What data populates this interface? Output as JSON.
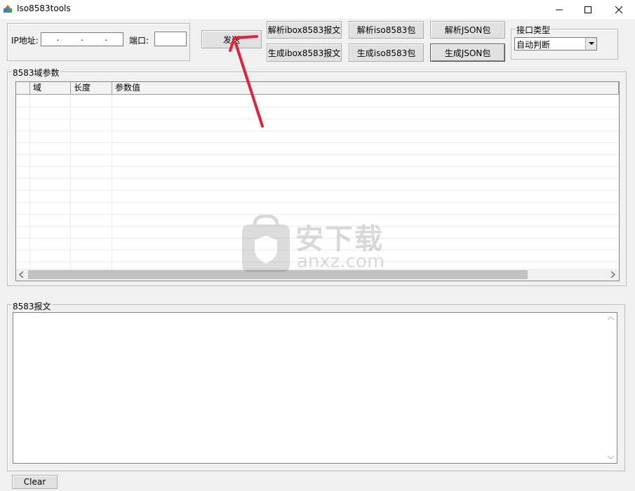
{
  "window": {
    "title": "Iso8583tools",
    "minimize_glyph": "—",
    "maximize_glyph": "☐",
    "close_glyph": "✕"
  },
  "connection": {
    "ip_label": "IP地址:",
    "ip_dots": ".        .        .",
    "port_label": "端口:",
    "port_value": ""
  },
  "buttons": {
    "send": "发送",
    "parse_ibox": "解析ibox8583报文",
    "gen_ibox": "生成ibox8583报文",
    "parse_iso": "解析iso8583包",
    "gen_iso": "生成iso8583包",
    "parse_json": "解析JSON包",
    "gen_json": "生成JSON包",
    "clear": "Clear"
  },
  "interface": {
    "legend": "接口类型",
    "selected": "自动判断"
  },
  "fields_group": {
    "legend": "8583域参数",
    "columns": [
      "域",
      "长度",
      "参数值"
    ]
  },
  "message_group": {
    "legend": "8583报文",
    "content": ""
  },
  "watermark": {
    "brand": "安下载",
    "site": "anxz.com"
  },
  "colors": {
    "annotation_arrow": "#e0223a"
  }
}
